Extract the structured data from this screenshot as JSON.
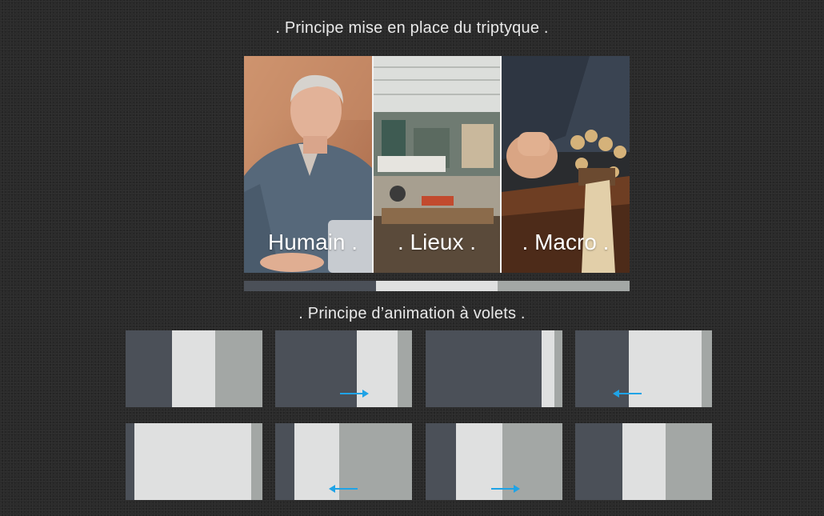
{
  "titles": {
    "top": ". Principe mise en place du triptyque .",
    "middle": ". Principe d’animation à volets ."
  },
  "triptych": {
    "panels": [
      {
        "label": "Humain .",
        "image": "photo-man-at-desk"
      },
      {
        "label": ". Lieux .",
        "image": "photo-workshop"
      },
      {
        "label": ". Macro .",
        "image": "photo-wood-carving-closeup"
      }
    ]
  },
  "colors": {
    "dark_gray": "#4b5058",
    "light_gray": "#dfe0e0",
    "mid_gray": "#a3a7a5",
    "arrow_blue": "#1fa3e6"
  },
  "legend_bar": [
    "dark",
    "light",
    "mid"
  ],
  "animation_frames": [
    {
      "segments": [
        "dark",
        "light",
        "mid"
      ],
      "arrow": "none"
    },
    {
      "segments": [
        "dark",
        "light",
        "mid"
      ],
      "arrow": "right"
    },
    {
      "segments": [
        "dark",
        "light",
        "mid"
      ],
      "arrow": "none"
    },
    {
      "segments": [
        "dark",
        "light",
        "mid"
      ],
      "arrow": "left"
    },
    {
      "segments": [
        "dark",
        "light",
        "mid"
      ],
      "arrow": "none"
    },
    {
      "segments": [
        "dark",
        "light",
        "mid"
      ],
      "arrow": "left"
    },
    {
      "segments": [
        "dark",
        "light",
        "mid"
      ],
      "arrow": "right"
    },
    {
      "segments": [
        "dark",
        "light",
        "mid"
      ],
      "arrow": "none"
    }
  ]
}
